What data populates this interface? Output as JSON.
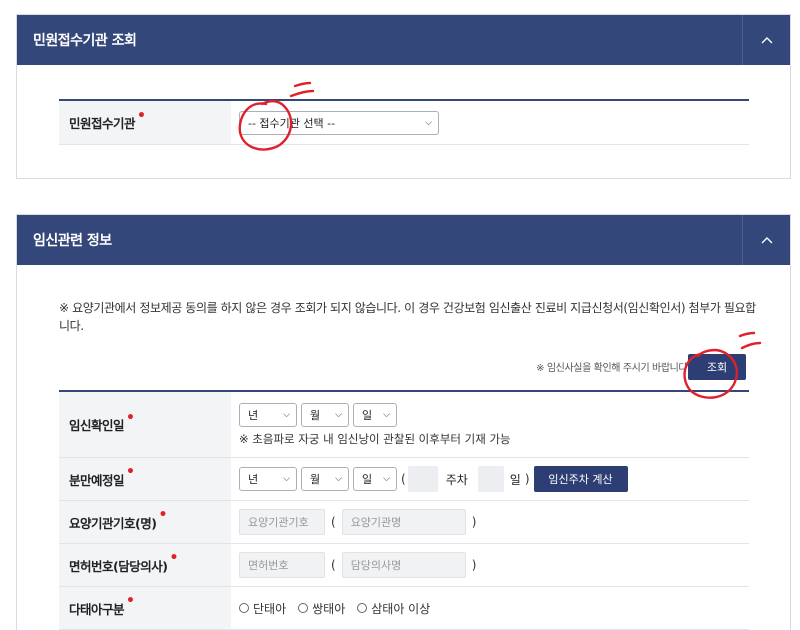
{
  "panel1": {
    "title": "민원접수기관 조회",
    "label": "민원접수기관",
    "select_value": "-- 접수기관 선택 --"
  },
  "panel2": {
    "title": "임신관련 정보",
    "note": "※ 요양기관에서 정보제공 동의를 하지 않은 경우 조회가 되지 않습니다. 이 경우 건강보험 임신출산 진료비 지급신청서(임신확인서) 첨부가 필요합니다.",
    "hint": "※ 임신사실을 확인해 주시기 바랍니다.",
    "lookup_button": "조회",
    "rows": {
      "confirm": {
        "label": "임신확인일",
        "year": "년",
        "month": "월",
        "day": "일",
        "sub": "※ 초음파로 자궁 내 임신낭이 관찰된 이후부터 기재 가능"
      },
      "due": {
        "label": "분만예정일",
        "year": "년",
        "month": "월",
        "day": "일",
        "paren_open": "(",
        "week_unit": "주차",
        "day_unit": "일",
        "paren_close": ")",
        "calc_button": "임신주차 계산"
      },
      "clinic": {
        "label": "요양기관기호(명)",
        "code_placeholder": "요양기관기호",
        "paren_open": "(",
        "name_placeholder": "요양기관명",
        "paren_close": ")"
      },
      "license": {
        "label": "면허번호(담당의사)",
        "license_placeholder": "면허번호",
        "paren_open": "(",
        "doctor_placeholder": "담당의사명",
        "paren_close": ")"
      },
      "multi": {
        "label": "다태아구분",
        "options": [
          "단태아",
          "쌍태아",
          "삼태아 이상"
        ]
      }
    }
  },
  "required_mark": "•",
  "colors": {
    "header": "#33477a",
    "button": "#2c3e74",
    "required": "#e0202a",
    "annotation": "#e0202a"
  }
}
